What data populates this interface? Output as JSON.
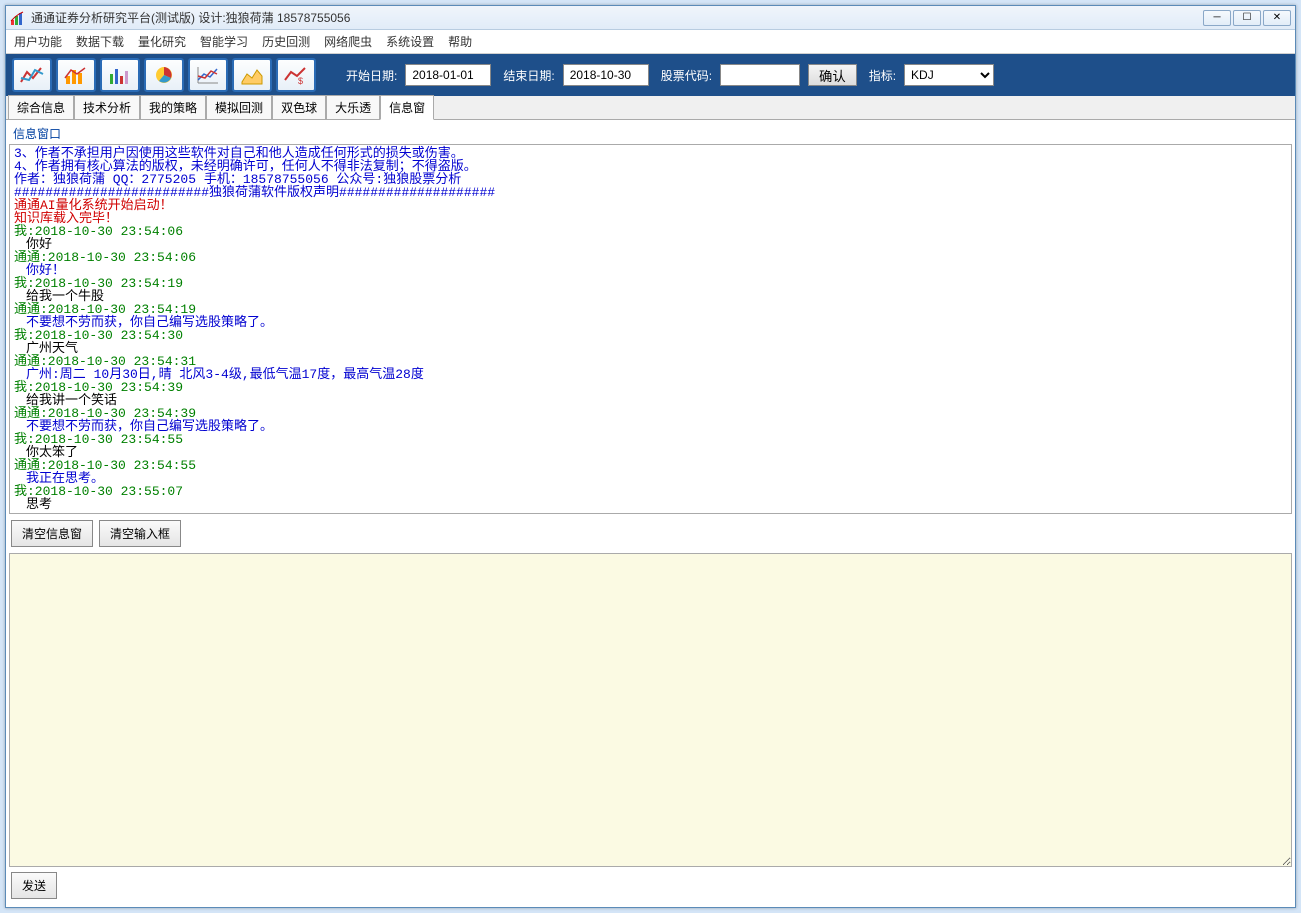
{
  "window": {
    "title": "通通证券分析研究平台(测试版) 设计:独狼荷蒲 18578755056"
  },
  "menu": {
    "items": [
      "用户功能",
      "数据下载",
      "量化研究",
      "智能学习",
      "历史回测",
      "网络爬虫",
      "系统设置",
      "帮助"
    ]
  },
  "toolbar": {
    "start_label": "开始日期:",
    "start_date": "2018-01-01",
    "end_label": "结束日期:",
    "end_date": "2018-10-30",
    "stock_label": "股票代码:",
    "stock_code": "",
    "confirm": "确认",
    "indicator_label": "指标:",
    "indicator_value": "KDJ"
  },
  "tabs": {
    "items": [
      "综合信息",
      "技术分析",
      "我的策略",
      "模拟回测",
      "双色球",
      "大乐透",
      "信息窗"
    ],
    "active": 6
  },
  "panel": {
    "title": "信息窗口"
  },
  "console_lines": [
    {
      "cls": "l-blue",
      "text": "3、作者不承担用户因使用这些软件对自己和他人造成任何形式的损失或伤害。"
    },
    {
      "cls": "l-blue",
      "text": "4、作者拥有核心算法的版权，未经明确许可，任何人不得非法复制；不得盗版。"
    },
    {
      "cls": "l-blue",
      "text": "作者：独狼荷蒲 QQ：2775205 手机：18578755056 公众号:独狼股票分析"
    },
    {
      "cls": "l-blue",
      "text": "#########################独狼荷蒲软件版权声明####################"
    },
    {
      "cls": "l-red",
      "text": "通通AI量化系统开始启动！"
    },
    {
      "cls": "l-red",
      "text": "知识库载入完毕！"
    },
    {
      "cls": "l-green",
      "text": "我:2018-10-30 23:54:06"
    },
    {
      "cls": "l-black indent",
      "text": "你好"
    },
    {
      "cls": "l-green",
      "text": "通通:2018-10-30 23:54:06"
    },
    {
      "cls": "l-blue indent",
      "text": "你好！"
    },
    {
      "cls": "l-green",
      "text": "我:2018-10-30 23:54:19"
    },
    {
      "cls": "l-black indent",
      "text": "给我一个牛股"
    },
    {
      "cls": "l-green",
      "text": "通通:2018-10-30 23:54:19"
    },
    {
      "cls": "l-blue indent",
      "text": "不要想不劳而获，你自己编写选股策略了。"
    },
    {
      "cls": "l-green",
      "text": "我:2018-10-30 23:54:30"
    },
    {
      "cls": "l-black indent",
      "text": "广州天气"
    },
    {
      "cls": "l-green",
      "text": "通通:2018-10-30 23:54:31"
    },
    {
      "cls": "l-blue indent",
      "text": "广州:周二 10月30日,晴 北风3-4级,最低气温17度，最高气温28度"
    },
    {
      "cls": "l-green",
      "text": "我:2018-10-30 23:54:39"
    },
    {
      "cls": "l-black indent",
      "text": "给我讲一个笑话"
    },
    {
      "cls": "l-green",
      "text": "通通:2018-10-30 23:54:39"
    },
    {
      "cls": "l-blue indent",
      "text": "不要想不劳而获，你自己编写选股策略了。"
    },
    {
      "cls": "l-green",
      "text": "我:2018-10-30 23:54:55"
    },
    {
      "cls": "l-black indent",
      "text": "你太笨了"
    },
    {
      "cls": "l-green",
      "text": "通通:2018-10-30 23:54:55"
    },
    {
      "cls": "l-blue indent",
      "text": "我正在思考。"
    },
    {
      "cls": "l-green",
      "text": "我:2018-10-30 23:55:07"
    },
    {
      "cls": "l-black indent",
      "text": "思考"
    }
  ],
  "buttons": {
    "clear_window": "清空信息窗",
    "clear_input": "清空输入框",
    "send": "发送"
  }
}
